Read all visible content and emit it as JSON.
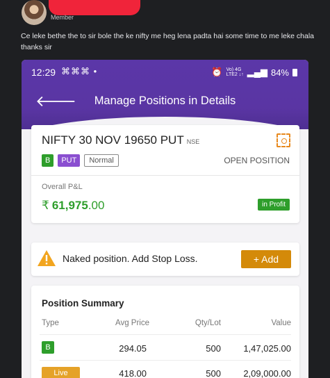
{
  "post": {
    "role": "Member",
    "message": "Ce leke bethe the to sir bole the ke nifty me heg lena padta hai some time to me leke chala thanks sir"
  },
  "status_bar": {
    "time": "12:29",
    "left_icons": "⌘⌘⌘ •",
    "network_top": "Vo) 4G",
    "network_bottom": "LTE2 ↓↑",
    "battery": "84%"
  },
  "screen": {
    "title": "Manage Positions in Details"
  },
  "position": {
    "symbol": "NIFTY 30 NOV 19650 PUT",
    "exchange": "NSE",
    "tags": {
      "side": "B",
      "type": "PUT",
      "product": "Normal"
    },
    "status": "OPEN POSITION",
    "pnl_label": "Overall P&L",
    "currency": "₹",
    "pnl_whole": "61,975",
    "pnl_decimal": ".00",
    "profit_badge": "in Profit"
  },
  "alert": {
    "text": "Naked position. Add Stop Loss.",
    "button": "+ Add"
  },
  "summary": {
    "title": "Position Summary",
    "headers": {
      "type": "Type",
      "avg": "Avg Price",
      "qty": "Qty/Lot",
      "value": "Value"
    },
    "rows": [
      {
        "type": "B",
        "avg": "294.05",
        "qty": "500",
        "value": "1,47,025.00"
      },
      {
        "type": "Live",
        "avg": "418.00",
        "qty": "500",
        "value": "2,09,000.00"
      }
    ]
  },
  "colors": {
    "brand": "#5b37a8",
    "profit": "#2e9e2b",
    "accent": "#d48a09",
    "redaction": "#f0243a"
  }
}
